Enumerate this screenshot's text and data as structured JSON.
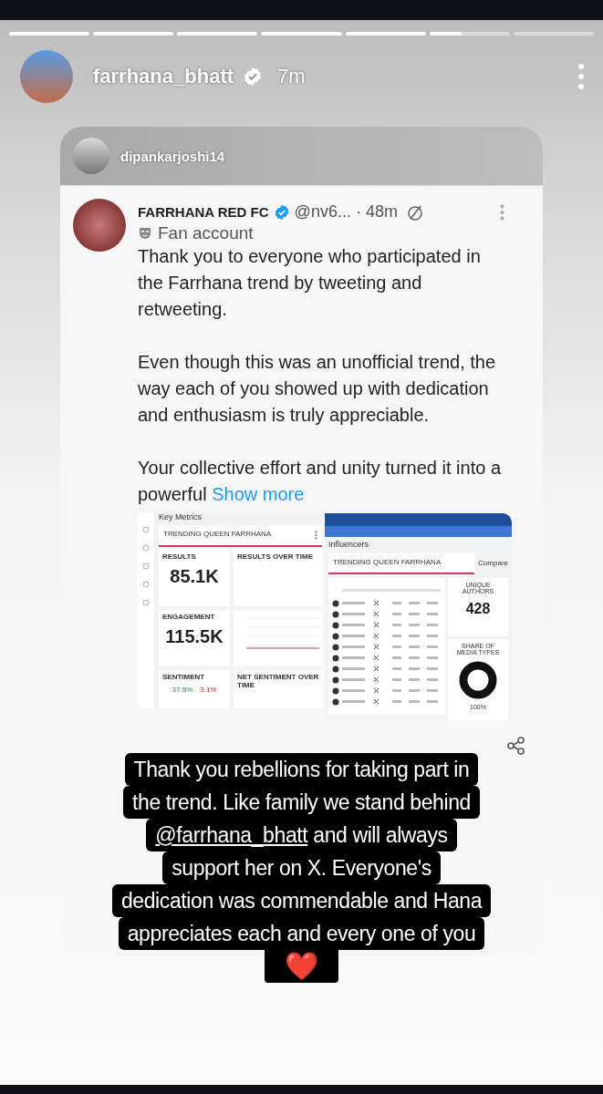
{
  "story": {
    "segments": [
      {
        "level": 1
      },
      {
        "level": 1
      },
      {
        "level": 1
      },
      {
        "level": 1
      },
      {
        "level": 1
      },
      {
        "level": 0.4
      },
      {
        "level": 0
      }
    ],
    "username": "farrhana_bhatt",
    "verified": true,
    "time": "7m"
  },
  "shared_post": {
    "author": "dipankarjoshi14",
    "tweet": {
      "name": "FARRHANA RED FC",
      "verified": true,
      "handle": "@nv6...",
      "time": "· 48m",
      "label": "Fan account",
      "paragraphs": [
        "Thank you to everyone who participated in the Farrhana trend by tweeting and retweeting.",
        "Even though this was an unofficial trend, the way each of you showed up with dedication and enthusiasm is truly appreciable.",
        "Your collective effort and unity turned it into a powerful"
      ],
      "show_more": "Show more"
    },
    "metrics_screenshot": {
      "title": "Key Metrics",
      "search": "TRENDING QUEEN FARRHANA",
      "stats": [
        {
          "label": "RESULTS",
          "value": "85.1K"
        },
        {
          "label": "ENGAGEMENT",
          "value": "115.5K"
        }
      ],
      "charts": [
        "RESULTS OVER TIME",
        "NET SENTIMENT OVER TIME"
      ],
      "sentiment": {
        "label": "SENTIMENT",
        "positive": "37.5%",
        "negative": "3.1%"
      }
    },
    "influencers_screenshot": {
      "title": "Influencers",
      "search": "TRENDING QUEEN FARRHANA",
      "compare": "Compare",
      "authors_label": "UNIQUE AUTHORS",
      "authors": "428",
      "media_label": "SHARE OF MEDIA TYPES",
      "media_share": "100%"
    }
  },
  "caption": {
    "lines": [
      {
        "text": "Thank you rebellions for taking part in"
      },
      {
        "text": "the trend. Like family we stand behind"
      },
      {
        "mention": "@farrhana_bhatt",
        "text": " and will always"
      },
      {
        "text": "support her on X. Everyone's"
      },
      {
        "text": "dedication was commendable and Hana"
      },
      {
        "text": "appreciates each and every one of you"
      },
      {
        "text": "❤️"
      }
    ]
  }
}
